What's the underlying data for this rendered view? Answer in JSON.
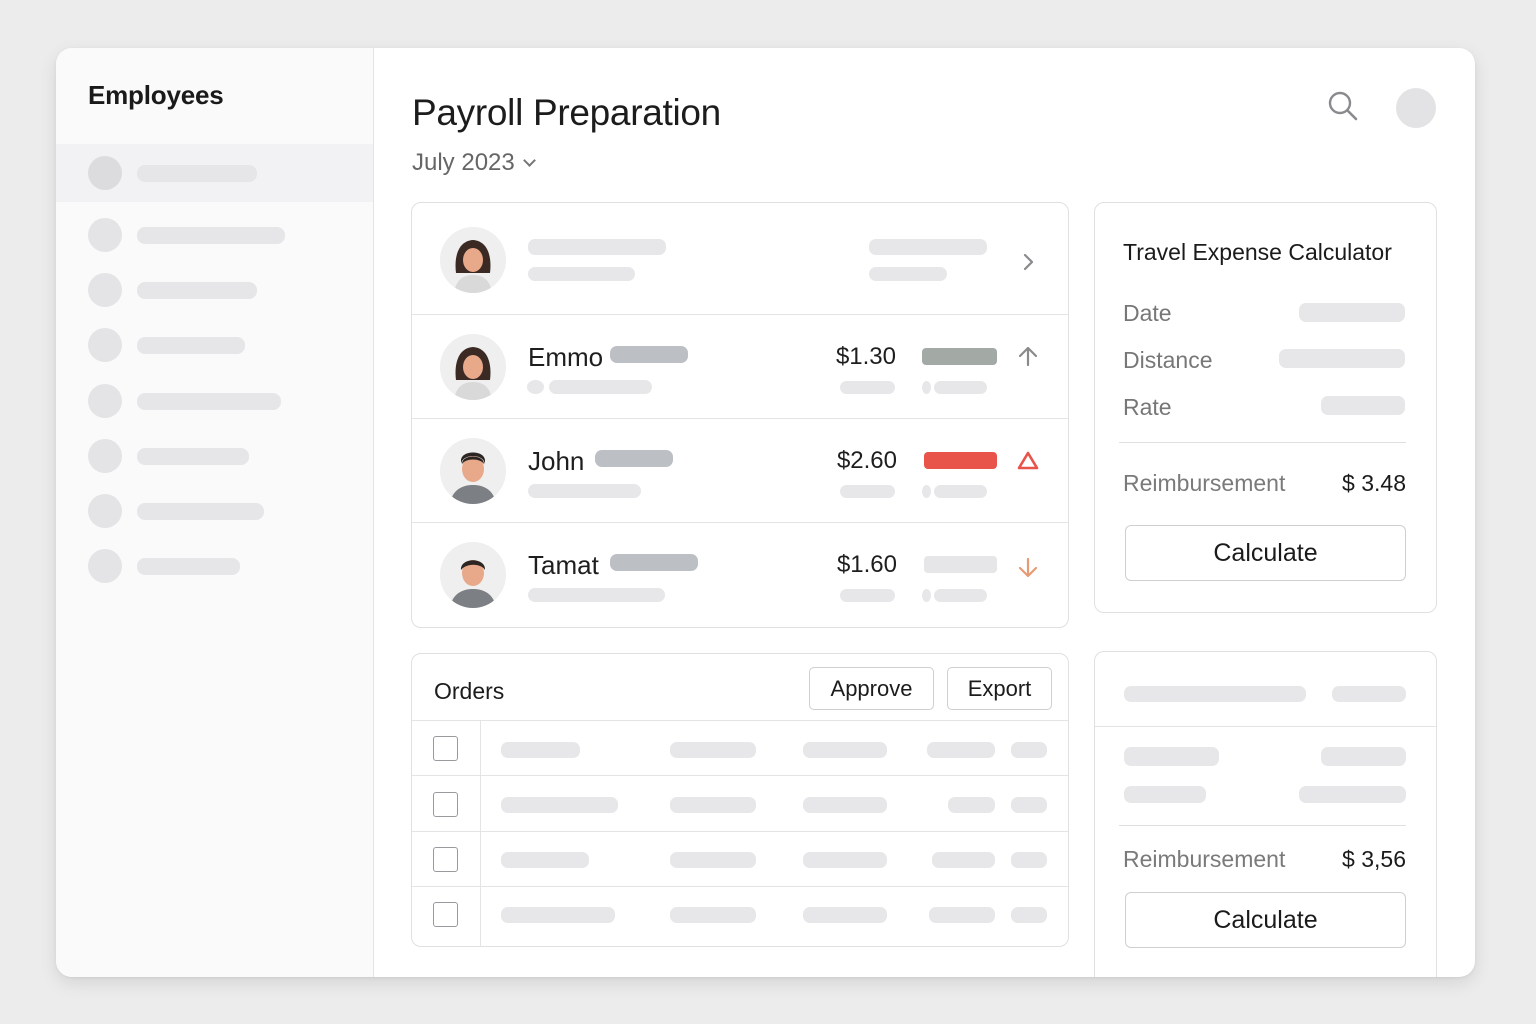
{
  "sidebar": {
    "title": "Employees",
    "items": [
      {
        "placeholder": true
      },
      {
        "placeholder": true
      },
      {
        "placeholder": true
      },
      {
        "placeholder": true
      },
      {
        "placeholder": true
      },
      {
        "placeholder": true
      },
      {
        "placeholder": true
      },
      {
        "placeholder": true
      }
    ]
  },
  "header": {
    "title": "Payroll Preparation",
    "period": "July 2023",
    "search_icon": "search-icon",
    "avatar_icon": "user-avatar"
  },
  "employees": {
    "rows": [
      {
        "name": "",
        "amount": "",
        "trend": "chevron-right"
      },
      {
        "name": "Emmo",
        "amount": "$1.30",
        "status_color": "#a3aaa6",
        "trend": "arrow-up"
      },
      {
        "name": "John",
        "amount": "$2.60",
        "status_color": "#e8534a",
        "trend": "warning-triangle"
      },
      {
        "name": "Tamat",
        "amount": "$1.60",
        "status_color": "#e6e6e8",
        "trend": "arrow-down"
      }
    ]
  },
  "calculator": {
    "title": "Travel Expense Calculator",
    "fields": {
      "date": "Date",
      "distance": "Distance",
      "rate": "Rate"
    },
    "reimbursement_label": "Reimbursement",
    "reimbursement_value": "$ 3.48",
    "button": "Calculate"
  },
  "orders": {
    "title": "Orders",
    "approve": "Approve",
    "export": "Export",
    "row_count": 4
  },
  "calculator2": {
    "reimbursement_label": "Reimbursement",
    "reimbursement_value": "$ 3,56",
    "button": "Calculate"
  },
  "colors": {
    "accent_red": "#e8534a",
    "trend_up": "#8a8a8a",
    "trend_down": "#e79a74"
  }
}
